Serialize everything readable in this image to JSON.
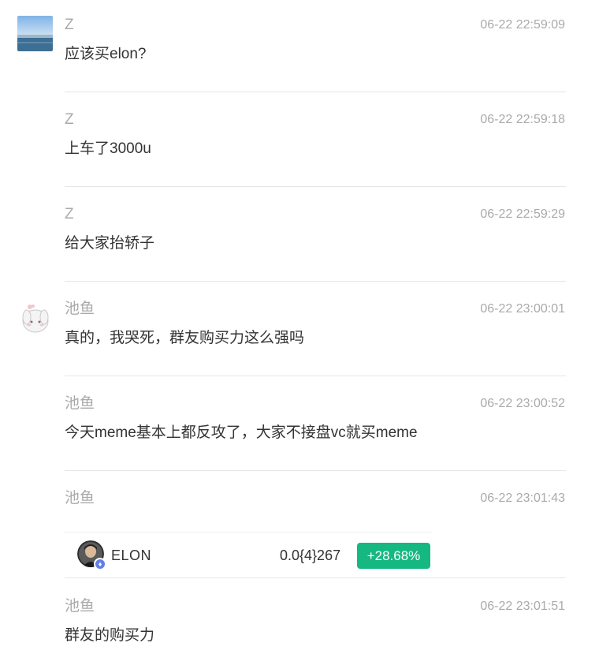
{
  "messages": [
    {
      "sender": "Z",
      "time": "06-22 22:59:09",
      "text": "应该买elon?"
    },
    {
      "sender": "Z",
      "time": "06-22 22:59:18",
      "text": "上车了3000u"
    },
    {
      "sender": "Z",
      "time": "06-22 22:59:29",
      "text": "给大家抬轿子"
    },
    {
      "sender": "池鱼",
      "time": "06-22 23:00:01",
      "text": "真的，我哭死，群友购买力这么强吗"
    },
    {
      "sender": "池鱼",
      "time": "06-22 23:00:52",
      "text": "今天meme基本上都反攻了，大家不接盘vc就买meme"
    },
    {
      "sender": "池鱼",
      "time": "06-22 23:01:43",
      "card": {
        "symbol": "ELON",
        "price": "0.0{4}267",
        "change": "+28.68%",
        "change_color": "#16b882",
        "chain_icon": "ethereum-icon"
      }
    },
    {
      "sender": "池鱼",
      "time": "06-22 23:01:51",
      "text": "群友的购买力"
    }
  ]
}
